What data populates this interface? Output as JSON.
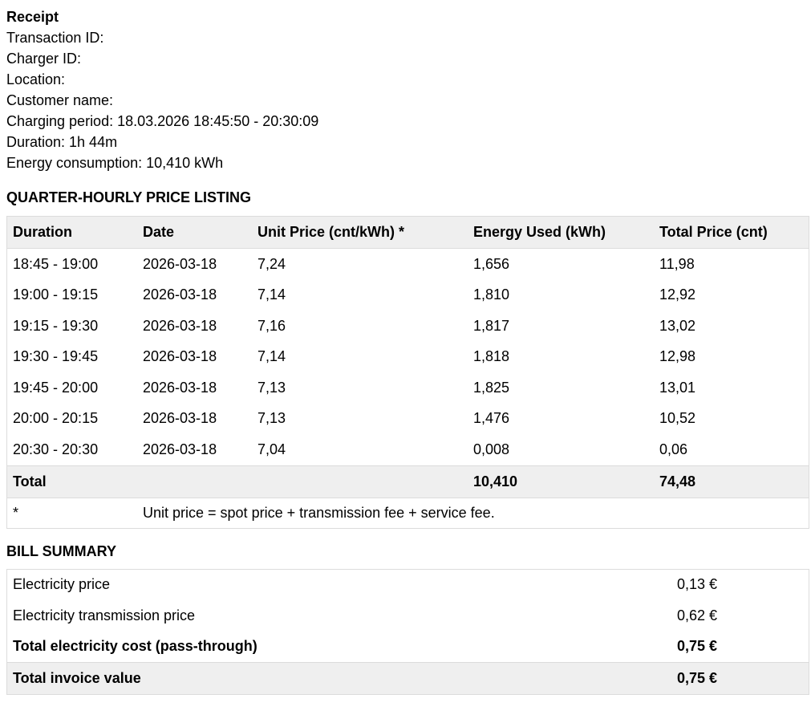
{
  "receipt": {
    "title": "Receipt",
    "transaction_id": "Transaction ID:",
    "charger_id": "Charger ID:",
    "location": "Location:",
    "customer_name": "Customer name:",
    "charging_period": "Charging period: 18.03.2026 18:45:50 - 20:30:09",
    "duration": "Duration: 1h 44m",
    "energy_consumption": "Energy consumption: 10,410 kWh"
  },
  "price_listing": {
    "title": "QUARTER-HOURLY PRICE LISTING",
    "headers": [
      "Duration",
      "Date",
      "Unit Price (cnt/kWh) *",
      "Energy Used (kWh)",
      "Total Price (cnt)"
    ],
    "rows": [
      [
        "18:45 - 19:00",
        "2026-03-18",
        "7,24",
        "1,656",
        "11,98"
      ],
      [
        "19:00 - 19:15",
        "2026-03-18",
        "7,14",
        "1,810",
        "12,92"
      ],
      [
        "19:15 - 19:30",
        "2026-03-18",
        "7,16",
        "1,817",
        "13,02"
      ],
      [
        "19:30 - 19:45",
        "2026-03-18",
        "7,14",
        "1,818",
        "12,98"
      ],
      [
        "19:45 - 20:00",
        "2026-03-18",
        "7,13",
        "1,825",
        "13,01"
      ],
      [
        "20:00 - 20:15",
        "2026-03-18",
        "7,13",
        "1,476",
        "10,52"
      ],
      [
        "20:30 - 20:30",
        "2026-03-18",
        "7,04",
        "0,008",
        "0,06"
      ]
    ],
    "total": {
      "label": "Total",
      "energy": "10,410",
      "price": "74,48"
    },
    "note": {
      "marker": "*",
      "text": "Unit price = spot price + transmission fee + service fee."
    }
  },
  "bill_summary": {
    "title": "BILL SUMMARY",
    "rows": [
      {
        "label": "Electricity price",
        "value": "0,13 €"
      },
      {
        "label": "Electricity transmission price",
        "value": "0,62 €"
      },
      {
        "label": "Total electricity cost (pass-through)",
        "value": "0,75 €"
      },
      {
        "label": "Total invoice value",
        "value": "0,75 €"
      }
    ]
  },
  "colors": {
    "header_bg": "#efefef",
    "border": "#dcdcdc"
  }
}
